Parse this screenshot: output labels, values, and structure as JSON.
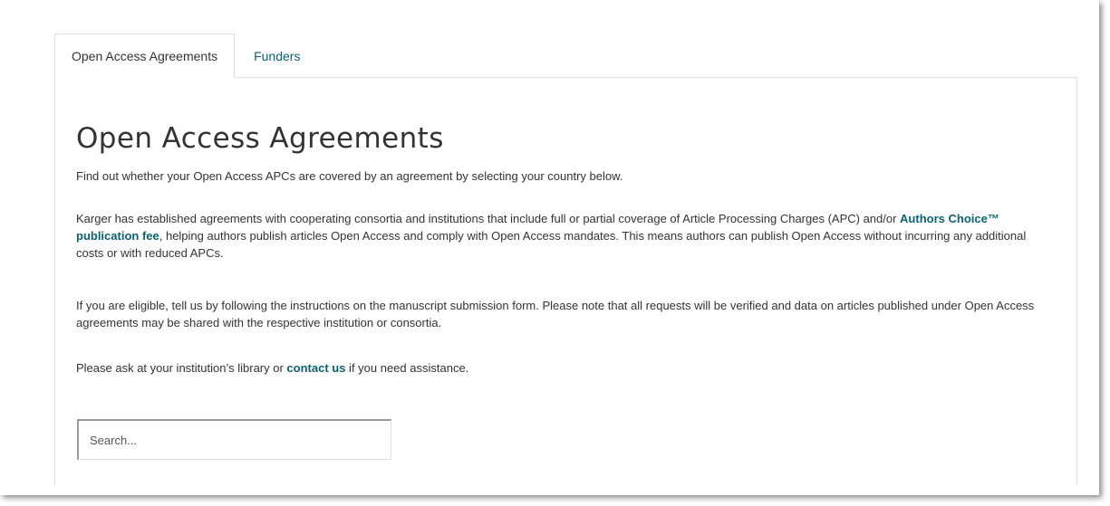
{
  "tabs": [
    {
      "label": "Open Access Agreements",
      "active": true
    },
    {
      "label": "Funders",
      "active": false
    }
  ],
  "main": {
    "title": "Open Access Agreements",
    "intro": "Find out whether your Open Access APCs are covered by an agreement by selecting your country below.",
    "para2_part1": "Karger has established agreements with cooperating consortia and institutions that include full or partial coverage of Article Processing Charges (APC) and/or ",
    "para2_link": "Authors Choice™ publication fee",
    "para2_part2": ", helping authors publish articles Open Access and comply with Open Access mandates. This means authors can publish Open Access without incurring any additional costs or with reduced APCs.",
    "para3": "If you are eligible, tell us by following the instructions on the manuscript submission form. Please note that all requests will be verified and data on articles published under Open Access agreements may be shared with the respective institution or consortia.",
    "para4_part1": "Please ask at your institution’s library or ",
    "para4_link": "contact us",
    "para4_part2": " if you need assistance."
  },
  "search": {
    "placeholder": "Search..."
  },
  "colors": {
    "link": "#0d6170",
    "text": "#333333",
    "border": "#dddddd"
  }
}
